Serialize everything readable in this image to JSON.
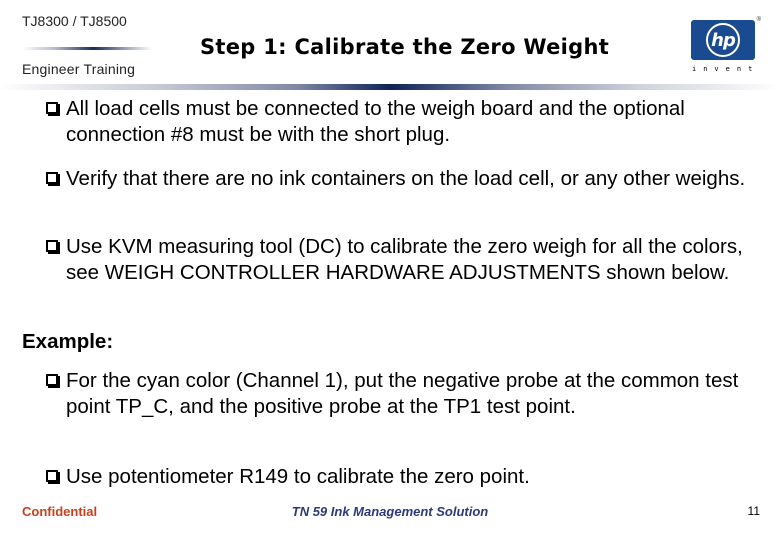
{
  "header": {
    "product": "TJ8300 / TJ8500",
    "subtitle": "Engineer Training",
    "title": "Step 1: Calibrate the Zero Weight",
    "logo": {
      "text": "hp",
      "registered": "®",
      "tagline": "invent",
      "color": "#1a4a8f"
    }
  },
  "bullets": [
    {
      "icon": "checkbox-bullet-icon",
      "text": "All load cells must be connected to the weigh board and the optional connection #8 must be with the short plug."
    },
    {
      "icon": "checkbox-bullet-icon",
      "text": "Verify that there are no ink containers on the load cell, or any other weighs."
    },
    {
      "icon": "checkbox-bullet-icon",
      "text": "Use KVM measuring tool (DC) to calibrate the zero weigh for all the colors, see WEIGH CONTROLLER HARDWARE ADJUSTMENTS shown below."
    }
  ],
  "example_label": "Example:",
  "example_bullets": [
    {
      "icon": "checkbox-bullet-icon",
      "text": "For the cyan color (Channel 1), put the negative probe at the common test point TP_C, and the positive probe at the TP1 test point."
    },
    {
      "icon": "checkbox-bullet-icon",
      "text": "Use potentiometer R149 to calibrate the zero point."
    }
  ],
  "footer": {
    "left": "Confidential",
    "center": "TN 59 Ink Management Solution",
    "page_number": "11",
    "left_color": "#c8401c",
    "center_color": "#2b3a7a"
  }
}
